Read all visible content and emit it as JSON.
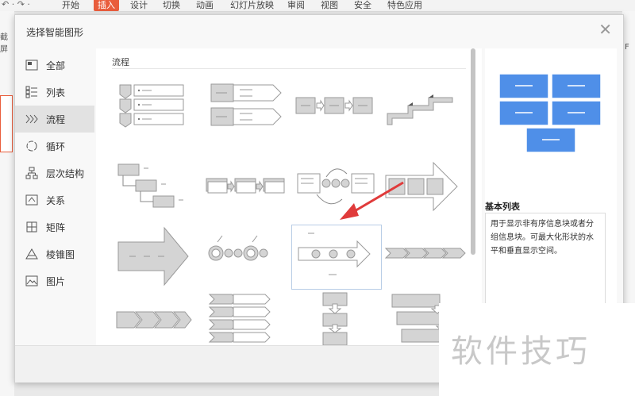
{
  "ribbon": {
    "quick_access": "↶ ·  ↷ ·",
    "tabs": [
      "开始",
      "插入",
      "设计",
      "切换",
      "动画",
      "幻灯片放映",
      "审阅",
      "视图",
      "安全",
      "特色应用"
    ],
    "active_tab": "插入",
    "screenshot_label": "截屏",
    "right_label": "F"
  },
  "dialog": {
    "title": "选择智能图形",
    "close_icon": "close-icon"
  },
  "nav": {
    "items": [
      {
        "label": "全部",
        "icon": "all-icon"
      },
      {
        "label": "列表",
        "icon": "list-icon"
      },
      {
        "label": "流程",
        "icon": "process-icon"
      },
      {
        "label": "循环",
        "icon": "cycle-icon"
      },
      {
        "label": "层次结构",
        "icon": "hierarchy-icon"
      },
      {
        "label": "关系",
        "icon": "relationship-icon"
      },
      {
        "label": "矩阵",
        "icon": "matrix-icon"
      },
      {
        "label": "棱锥图",
        "icon": "pyramid-icon"
      },
      {
        "label": "图片",
        "icon": "picture-icon"
      }
    ],
    "active_index": 2
  },
  "gallery": {
    "section_label": "流程",
    "selected_index": 10
  },
  "preview": {
    "name": "基本列表",
    "description": "用于显示非有序信息块或者分组信息块。可最大化形状的水平和垂直显示空间。",
    "shape_color": "#4f8fe8"
  },
  "watermark": "软件技巧",
  "colors": {
    "accent": "#e95d3c",
    "shape_fill": "#d4d4d4",
    "shape_stroke": "#9a9a9a",
    "annotation_arrow": "#e03b3b"
  }
}
